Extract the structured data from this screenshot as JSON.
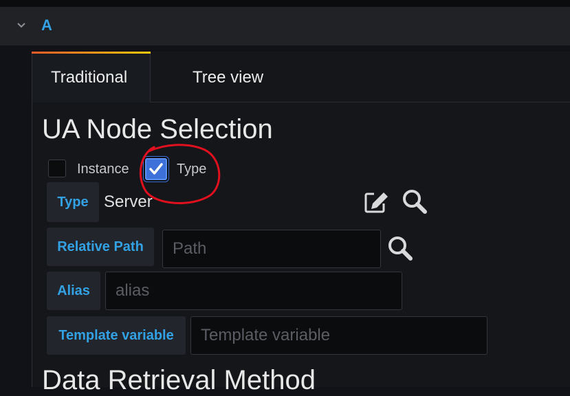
{
  "query": {
    "name": "A"
  },
  "tabs": [
    {
      "label": "Traditional",
      "active": true
    },
    {
      "label": "Tree view",
      "active": false
    }
  ],
  "node_selection": {
    "title": "UA Node Selection",
    "instance_label": "Instance",
    "instance_checked": false,
    "type_label": "Type",
    "type_checked": true,
    "type_field_label": "Type",
    "type_value": "Server",
    "relative_path_label": "Relative Path",
    "relative_path_placeholder": "Path",
    "alias_label": "Alias",
    "alias_placeholder": "alias",
    "template_variable_label": "Template variable",
    "template_variable_placeholder": "Template variable"
  },
  "data_retrieval": {
    "title": "Data Retrieval Method"
  },
  "colors": {
    "accent_blue": "#33a2e5",
    "checkbox_blue": "#3d71d9",
    "annotation_red": "#e0101e",
    "tab_gradient_start": "#f05a28",
    "tab_gradient_end": "#fbca0a"
  }
}
